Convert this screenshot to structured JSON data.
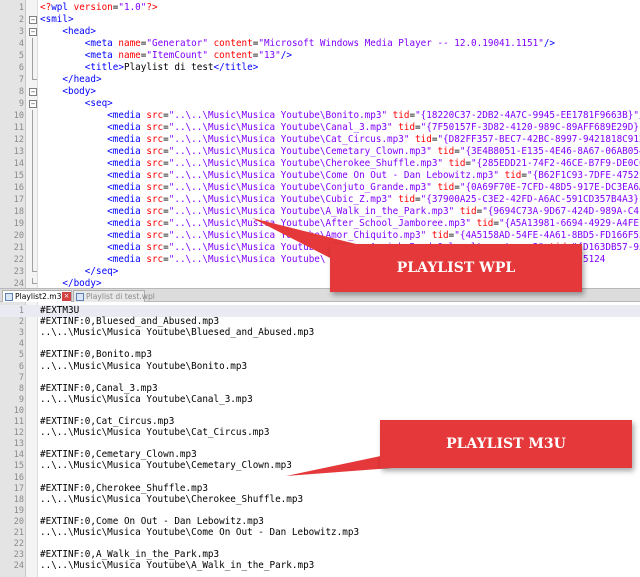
{
  "wpl": {
    "lines": [
      {
        "n": "1",
        "fold": "",
        "tokens": [
          {
            "c": "pi",
            "t": "<?"
          },
          {
            "c": "t",
            "t": "wpl"
          },
          {
            "c": "a",
            "t": " version"
          },
          {
            "c": "tx",
            "t": "="
          },
          {
            "c": "s",
            "t": "\"1.0\""
          },
          {
            "c": "pi",
            "t": "?>"
          }
        ]
      },
      {
        "n": "2",
        "fold": "open",
        "tokens": [
          {
            "c": "t",
            "t": "<smil>"
          }
        ]
      },
      {
        "n": "3",
        "fold": "open",
        "tokens": [
          {
            "c": "tx",
            "t": "    "
          },
          {
            "c": "t",
            "t": "<head>"
          }
        ]
      },
      {
        "n": "4",
        "fold": "line",
        "tokens": [
          {
            "c": "tx",
            "t": "        "
          },
          {
            "c": "t",
            "t": "<meta"
          },
          {
            "c": "a",
            "t": " name"
          },
          {
            "c": "tx",
            "t": "="
          },
          {
            "c": "s",
            "t": "\"Generator\""
          },
          {
            "c": "a",
            "t": " content"
          },
          {
            "c": "tx",
            "t": "="
          },
          {
            "c": "s",
            "t": "\"Microsoft Windows Media Player -- 12.0.19041.1151\""
          },
          {
            "c": "t",
            "t": "/>"
          }
        ]
      },
      {
        "n": "5",
        "fold": "line",
        "tokens": [
          {
            "c": "tx",
            "t": "        "
          },
          {
            "c": "t",
            "t": "<meta"
          },
          {
            "c": "a",
            "t": " name"
          },
          {
            "c": "tx",
            "t": "="
          },
          {
            "c": "s",
            "t": "\"ItemCount\""
          },
          {
            "c": "a",
            "t": " content"
          },
          {
            "c": "tx",
            "t": "="
          },
          {
            "c": "s",
            "t": "\"13\""
          },
          {
            "c": "t",
            "t": "/>"
          }
        ]
      },
      {
        "n": "6",
        "fold": "line",
        "tokens": [
          {
            "c": "tx",
            "t": "        "
          },
          {
            "c": "t",
            "t": "<title>"
          },
          {
            "c": "tx",
            "t": "Playlist di test"
          },
          {
            "c": "t",
            "t": "</title>"
          }
        ]
      },
      {
        "n": "7",
        "fold": "end",
        "tokens": [
          {
            "c": "tx",
            "t": "    "
          },
          {
            "c": "t",
            "t": "</head>"
          }
        ]
      },
      {
        "n": "8",
        "fold": "open",
        "tokens": [
          {
            "c": "tx",
            "t": "    "
          },
          {
            "c": "t",
            "t": "<body>"
          }
        ]
      },
      {
        "n": "9",
        "fold": "open",
        "tokens": [
          {
            "c": "tx",
            "t": "        "
          },
          {
            "c": "t",
            "t": "<seq>"
          }
        ]
      },
      {
        "n": "10",
        "fold": "line",
        "tokens": [
          {
            "c": "tx",
            "t": "            "
          },
          {
            "c": "t",
            "t": "<media"
          },
          {
            "c": "a",
            "t": " src"
          },
          {
            "c": "tx",
            "t": "="
          },
          {
            "c": "s",
            "t": "\"..\\..\\Music\\Musica Youtube\\Bonito.mp3\""
          },
          {
            "c": "a",
            "t": " tid"
          },
          {
            "c": "tx",
            "t": "="
          },
          {
            "c": "s",
            "t": "\"{18220C37-2DB2-4A7C-9945-EE1781F9663B}\""
          },
          {
            "c": "t",
            "t": "/>"
          }
        ]
      },
      {
        "n": "11",
        "fold": "line",
        "tokens": [
          {
            "c": "tx",
            "t": "            "
          },
          {
            "c": "t",
            "t": "<media"
          },
          {
            "c": "a",
            "t": " src"
          },
          {
            "c": "tx",
            "t": "="
          },
          {
            "c": "s",
            "t": "\"..\\..\\Music\\Musica Youtube\\Canal_3.mp3\""
          },
          {
            "c": "a",
            "t": " tid"
          },
          {
            "c": "tx",
            "t": "="
          },
          {
            "c": "s",
            "t": "\"{7F50157F-3D82-4120-989C-89AFF689E29D}\""
          },
          {
            "c": "t",
            "t": "/>"
          }
        ]
      },
      {
        "n": "12",
        "fold": "line",
        "tokens": [
          {
            "c": "tx",
            "t": "            "
          },
          {
            "c": "t",
            "t": "<media"
          },
          {
            "c": "a",
            "t": " src"
          },
          {
            "c": "tx",
            "t": "="
          },
          {
            "c": "s",
            "t": "\"..\\..\\Music\\Musica Youtube\\Cat_Circus.mp3\""
          },
          {
            "c": "a",
            "t": " tid"
          },
          {
            "c": "tx",
            "t": "="
          },
          {
            "c": "s",
            "t": "\"{D82FF357-BEC7-42BC-8997-9421818C912C}\""
          },
          {
            "c": "t",
            "t": "/>"
          }
        ]
      },
      {
        "n": "13",
        "fold": "line",
        "tokens": [
          {
            "c": "tx",
            "t": "            "
          },
          {
            "c": "t",
            "t": "<media"
          },
          {
            "c": "a",
            "t": " src"
          },
          {
            "c": "tx",
            "t": "="
          },
          {
            "c": "s",
            "t": "\"..\\..\\Music\\Musica Youtube\\Cemetary_Clown.mp3\""
          },
          {
            "c": "a",
            "t": " tid"
          },
          {
            "c": "tx",
            "t": "="
          },
          {
            "c": "s",
            "t": "\"{3E4B8051-E135-4E46-8A67-06AB054E}\""
          },
          {
            "c": "t",
            "t": "/>"
          }
        ]
      },
      {
        "n": "14",
        "fold": "line",
        "tokens": [
          {
            "c": "tx",
            "t": "            "
          },
          {
            "c": "t",
            "t": "<media"
          },
          {
            "c": "a",
            "t": " src"
          },
          {
            "c": "tx",
            "t": "="
          },
          {
            "c": "s",
            "t": "\"..\\..\\Music\\Musica Youtube\\Cherokee_Shuffle.mp3\""
          },
          {
            "c": "a",
            "t": " tid"
          },
          {
            "c": "tx",
            "t": "="
          },
          {
            "c": "s",
            "t": "\"{285EDD21-74F2-46CE-B7F9-DE0CC\""
          },
          {
            "c": "t",
            "t": "/>"
          }
        ]
      },
      {
        "n": "15",
        "fold": "line",
        "tokens": [
          {
            "c": "tx",
            "t": "            "
          },
          {
            "c": "t",
            "t": "<media"
          },
          {
            "c": "a",
            "t": " src"
          },
          {
            "c": "tx",
            "t": "="
          },
          {
            "c": "s",
            "t": "\"..\\..\\Music\\Musica Youtube\\Come On Out - Dan Lebowitz.mp3\""
          },
          {
            "c": "a",
            "t": " tid"
          },
          {
            "c": "tx",
            "t": "="
          },
          {
            "c": "s",
            "t": "\"{B62F1C93-7DFE-4752-9\""
          },
          {
            "c": "t",
            "t": "/>"
          }
        ]
      },
      {
        "n": "16",
        "fold": "line",
        "tokens": [
          {
            "c": "tx",
            "t": "            "
          },
          {
            "c": "t",
            "t": "<media"
          },
          {
            "c": "a",
            "t": " src"
          },
          {
            "c": "tx",
            "t": "="
          },
          {
            "c": "s",
            "t": "\"..\\..\\Music\\Musica Youtube\\Conjuto_Grande.mp3\""
          },
          {
            "c": "a",
            "t": " tid"
          },
          {
            "c": "tx",
            "t": "="
          },
          {
            "c": "s",
            "t": "\"{0A69F70E-7CFD-48D5-917E-DC3EA6A3\""
          },
          {
            "c": "t",
            "t": "/>"
          }
        ]
      },
      {
        "n": "17",
        "fold": "line",
        "tokens": [
          {
            "c": "tx",
            "t": "            "
          },
          {
            "c": "t",
            "t": "<media"
          },
          {
            "c": "a",
            "t": " src"
          },
          {
            "c": "tx",
            "t": "="
          },
          {
            "c": "s",
            "t": "\"..\\..\\Music\\Musica Youtube\\Cubic_Z.mp3\""
          },
          {
            "c": "a",
            "t": " tid"
          },
          {
            "c": "tx",
            "t": "="
          },
          {
            "c": "s",
            "t": "\"{37900A25-C3E2-42FD-A6AC-591CD357B4A3}\""
          },
          {
            "c": "t",
            "t": "/>"
          }
        ]
      },
      {
        "n": "18",
        "fold": "line",
        "tokens": [
          {
            "c": "tx",
            "t": "            "
          },
          {
            "c": "t",
            "t": "<media"
          },
          {
            "c": "a",
            "t": " src"
          },
          {
            "c": "tx",
            "t": "="
          },
          {
            "c": "s",
            "t": "\"..\\..\\Music\\Musica Youtube\\A_Walk_in_the_Park.mp3\""
          },
          {
            "c": "a",
            "t": " tid"
          },
          {
            "c": "tx",
            "t": "="
          },
          {
            "c": "s",
            "t": "\"{9694C73A-9D67-424D-989A-C4FC\""
          },
          {
            "c": "t",
            "t": "/>"
          }
        ]
      },
      {
        "n": "19",
        "fold": "line",
        "tokens": [
          {
            "c": "tx",
            "t": "            "
          },
          {
            "c": "t",
            "t": "<media"
          },
          {
            "c": "a",
            "t": " src"
          },
          {
            "c": "tx",
            "t": "="
          },
          {
            "c": "s",
            "t": "\"..\\..\\Music\\Musica Youtube\\After_School_Jamboree.mp3\""
          },
          {
            "c": "a",
            "t": " tid"
          },
          {
            "c": "tx",
            "t": "="
          },
          {
            "c": "s",
            "t": "\"{A5A13981-6694-4929-A4FE-8\""
          },
          {
            "c": "t",
            "t": "/>"
          }
        ]
      },
      {
        "n": "20",
        "fold": "line",
        "tokens": [
          {
            "c": "tx",
            "t": "            "
          },
          {
            "c": "t",
            "t": "<media"
          },
          {
            "c": "a",
            "t": " src"
          },
          {
            "c": "tx",
            "t": "="
          },
          {
            "c": "s",
            "t": "\"..\\..\\Music\\Musica Youtube\\Amor_Chiquito.mp3\""
          },
          {
            "c": "a",
            "t": " tid"
          },
          {
            "c": "tx",
            "t": "="
          },
          {
            "c": "s",
            "t": "\"{4A5158AD-54FE-4A61-8BD5-FD166F55\""
          },
          {
            "c": "t",
            "t": "/>"
          }
        ]
      },
      {
        "n": "21",
        "fold": "line",
        "tokens": [
          {
            "c": "tx",
            "t": "            "
          },
          {
            "c": "t",
            "t": "<media"
          },
          {
            "c": "a",
            "t": " src"
          },
          {
            "c": "tx",
            "t": "="
          },
          {
            "c": "s",
            "t": "\"..\\..\\Music\\Musica Youtube\\Anchors_Aweigh_Band_Only_alternate.mp3\""
          },
          {
            "c": "a",
            "t": " tid"
          },
          {
            "c": "tx",
            "t": "="
          },
          {
            "c": "s",
            "t": "\"{D163DB57-95\""
          },
          {
            "c": "t",
            "t": "/>"
          }
        ]
      },
      {
        "n": "22",
        "fold": "line",
        "tokens": [
          {
            "c": "tx",
            "t": "            "
          },
          {
            "c": "t",
            "t": "<media"
          },
          {
            "c": "a",
            "t": " src"
          },
          {
            "c": "tx",
            "t": "="
          },
          {
            "c": "s",
            "t": "\"..\\..\\Music\\Musica Youtube\\"
          },
          {
            "c": "tx",
            "t": "                                       "
          },
          {
            "c": "s",
            "t": "4-9B9B-5124"
          }
        ]
      },
      {
        "n": "23",
        "fold": "end",
        "tokens": [
          {
            "c": "tx",
            "t": "        "
          },
          {
            "c": "t",
            "t": "</seq>"
          }
        ]
      },
      {
        "n": "24",
        "fold": "end",
        "tokens": [
          {
            "c": "tx",
            "t": "    "
          },
          {
            "c": "t",
            "t": "</body>"
          }
        ]
      },
      {
        "n": "25",
        "fold": "end",
        "tokens": [
          {
            "c": "t",
            "t": "</smil>"
          }
        ]
      }
    ]
  },
  "tabs": [
    {
      "label": "Playlist2.m3u",
      "close": "×"
    },
    {
      "label": "Playlist di test.wpl"
    }
  ],
  "m3u": {
    "lines": [
      {
        "n": "1",
        "text": "#EXTM3U"
      },
      {
        "n": "2",
        "text": "#EXTINF:0,Bluesed_and_Abused.mp3"
      },
      {
        "n": "3",
        "text": "..\\..\\Music\\Musica Youtube\\Bluesed_and_Abused.mp3"
      },
      {
        "n": "4",
        "text": ""
      },
      {
        "n": "5",
        "text": "#EXTINF:0,Bonito.mp3"
      },
      {
        "n": "6",
        "text": "..\\..\\Music\\Musica Youtube\\Bonito.mp3"
      },
      {
        "n": "7",
        "text": ""
      },
      {
        "n": "8",
        "text": "#EXTINF:0,Canal_3.mp3"
      },
      {
        "n": "9",
        "text": "..\\..\\Music\\Musica Youtube\\Canal_3.mp3"
      },
      {
        "n": "10",
        "text": ""
      },
      {
        "n": "11",
        "text": "#EXTINF:0,Cat_Circus.mp3"
      },
      {
        "n": "12",
        "text": "..\\..\\Music\\Musica Youtube\\Cat_Circus.mp3"
      },
      {
        "n": "13",
        "text": ""
      },
      {
        "n": "14",
        "text": "#EXTINF:0,Cemetary_Clown.mp3"
      },
      {
        "n": "15",
        "text": "..\\..\\Music\\Musica Youtube\\Cemetary_Clown.mp3"
      },
      {
        "n": "16",
        "text": ""
      },
      {
        "n": "17",
        "text": "#EXTINF:0,Cherokee_Shuffle.mp3"
      },
      {
        "n": "18",
        "text": "..\\..\\Music\\Musica Youtube\\Cherokee_Shuffle.mp3"
      },
      {
        "n": "19",
        "text": ""
      },
      {
        "n": "20",
        "text": "#EXTINF:0,Come On Out - Dan Lebowitz.mp3"
      },
      {
        "n": "21",
        "text": "..\\..\\Music\\Musica Youtube\\Come On Out - Dan Lebowitz.mp3"
      },
      {
        "n": "22",
        "text": ""
      },
      {
        "n": "23",
        "text": "#EXTINF:0,A_Walk_in_the_Park.mp3"
      },
      {
        "n": "24",
        "text": "..\\..\\Music\\Musica Youtube\\A_Walk_in_the_Park.mp3"
      }
    ]
  },
  "callouts": {
    "wpl": "PLAYLIST WPL",
    "m3u": "PLAYLIST M3U"
  },
  "colors": {
    "tag": "#0000ff",
    "attribute": "#ff0000",
    "string": "#8000ff",
    "callout": "#e5383a"
  }
}
